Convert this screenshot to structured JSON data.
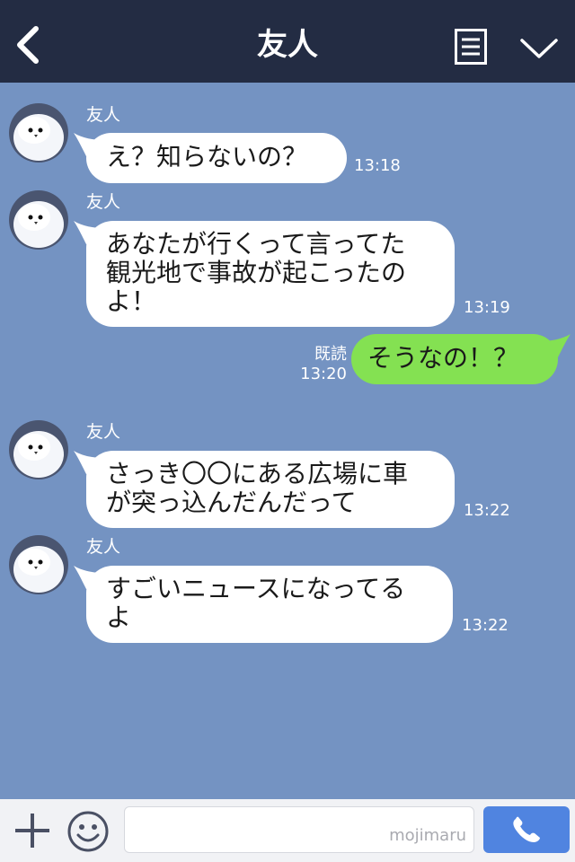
{
  "header": {
    "title": "友人",
    "back_icon": "chevron-left-icon",
    "menu_icon": "menu-list-icon",
    "dropdown_icon": "chevron-down-icon"
  },
  "messages": [
    {
      "sender": "友人",
      "lines": [
        "え？知らないの？"
      ],
      "time": "13:18"
    },
    {
      "sender": "友人",
      "lines": [
        "あなたが行くって言ってた",
        "観光地で事故が起こったの",
        "よ！"
      ],
      "time": "13:19"
    },
    {
      "sender": "me",
      "lines": [
        "そうなの！？"
      ],
      "read": "既読",
      "time": "13:20"
    },
    {
      "sender": "友人",
      "lines": [
        "さっき〇〇にある広場に車",
        "が突っ込んだんだって"
      ],
      "time": "13:22"
    },
    {
      "sender": "友人",
      "lines": [
        "すごいニュースになってる",
        "よ"
      ],
      "time": "13:22"
    }
  ],
  "input_bar": {
    "plus_icon": "plus-icon",
    "emoji_icon": "smiley-icon",
    "input_value": "",
    "watermark": "mojimaru",
    "send_icon": "phone-icon"
  },
  "colors": {
    "header_bg": "#232c43",
    "chat_bg": "#7493c2",
    "my_bubble": "#84e152",
    "send_button": "#5084e0"
  }
}
